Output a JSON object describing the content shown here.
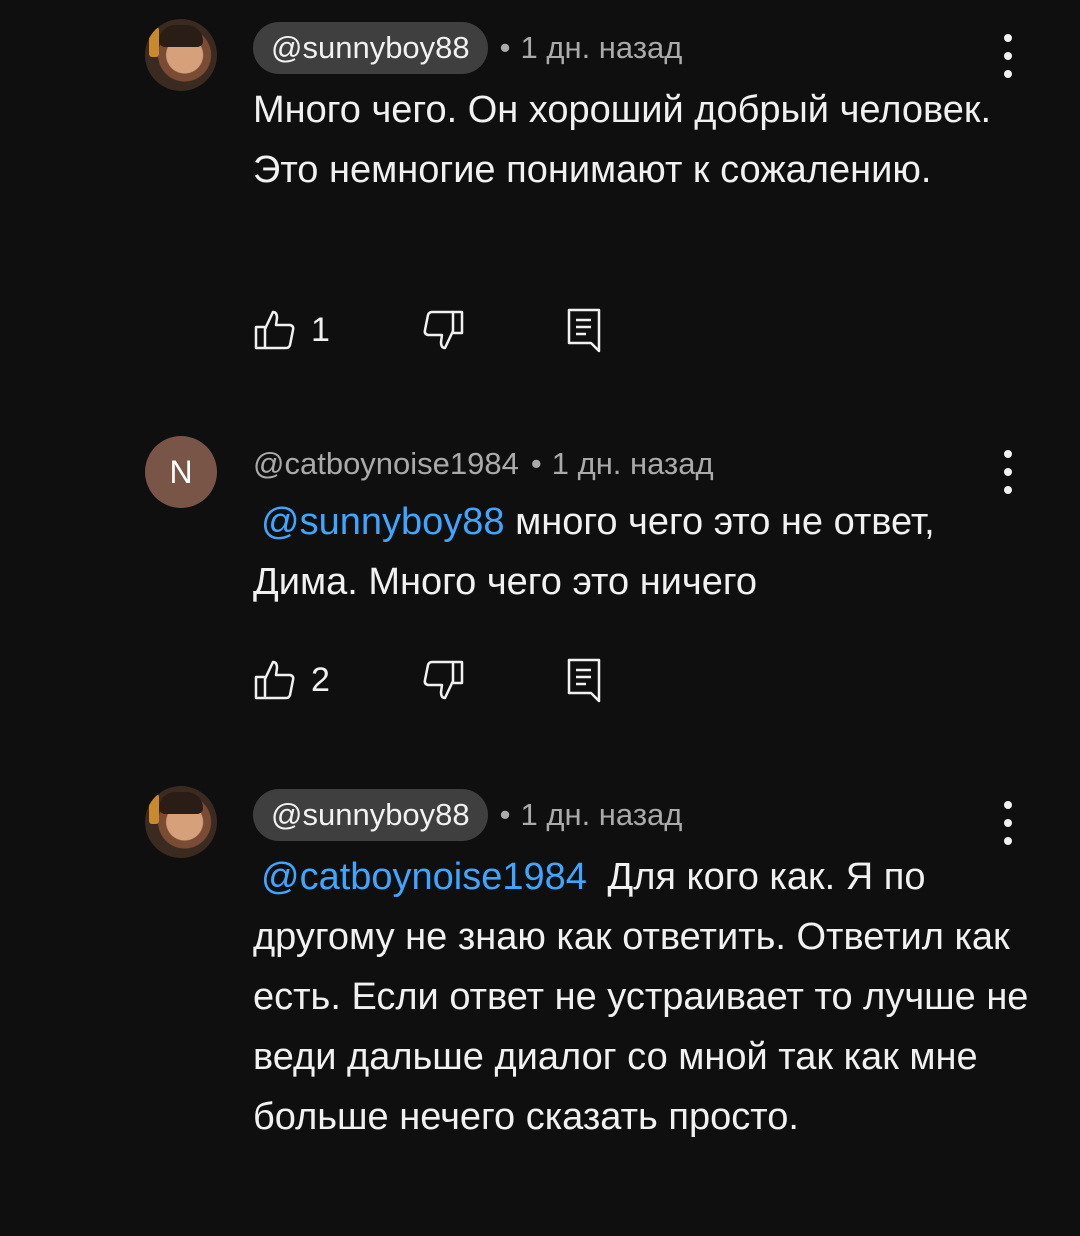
{
  "comments": [
    {
      "author": "@sunnyboy88",
      "separator": "•",
      "time": "1 дн. назад",
      "text": "Много чего. Он хороший добрый человек. Это немногие понимают к сожалению.",
      "likes": "1"
    },
    {
      "avatar_letter": "N",
      "author": "@catboynoise1984",
      "separator": "•",
      "time": "1 дн. назад",
      "mention": "@sunnyboy88",
      "text": "много чего это не ответ, Дима. Много чего это ничего",
      "likes": "2"
    },
    {
      "author": "@sunnyboy88",
      "separator": "•",
      "time": "1 дн. назад",
      "mention": "@catboynoise1984",
      "text": "Для кого как. Я по другому не знаю как ответить. Ответил как есть. Если ответ не устраивает то лучше не веди дальше диалог со мной так как мне больше нечего сказать просто."
    }
  ],
  "colors": {
    "background": "#0f0f0f",
    "mention": "#3ea6ff",
    "pill": "#3f3f3f",
    "secondary_text": "#aaaaaa"
  }
}
